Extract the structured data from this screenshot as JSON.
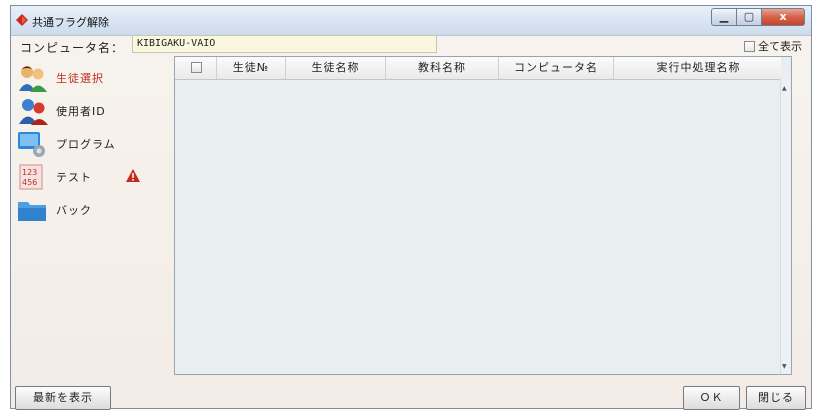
{
  "window": {
    "title": "共通フラグ解除",
    "controls": {
      "minimize_glyph": "▁",
      "maximize_glyph": "▢",
      "close_glyph": "x"
    }
  },
  "computer": {
    "label": "コンピュータ名：",
    "value": "KIBIGAKU-VAIO"
  },
  "show_all": {
    "label": "全て表示",
    "checked": false
  },
  "sidebar": {
    "items": [
      {
        "label": "生徒選択",
        "icon": "students-icon",
        "active": true
      },
      {
        "label": "使用者ID",
        "icon": "users-icon",
        "active": false
      },
      {
        "label": "プログラム",
        "icon": "program-icon",
        "active": false
      },
      {
        "label": "テスト",
        "icon": "test-icon",
        "active": false,
        "warning": true
      },
      {
        "label": "バック",
        "icon": "folder-icon",
        "active": false
      }
    ]
  },
  "table": {
    "columns": [
      "生徒№",
      "生徒名称",
      "教科名称",
      "コンピュータ名",
      "実行中処理名称"
    ],
    "rows": []
  },
  "buttons": {
    "refresh": "最新を表示",
    "ok": "ＯＫ",
    "close": "閉じる"
  },
  "colors": {
    "active_nav": "#c0301d",
    "warning": "#c8281e",
    "computer_field": "#faf7df"
  }
}
